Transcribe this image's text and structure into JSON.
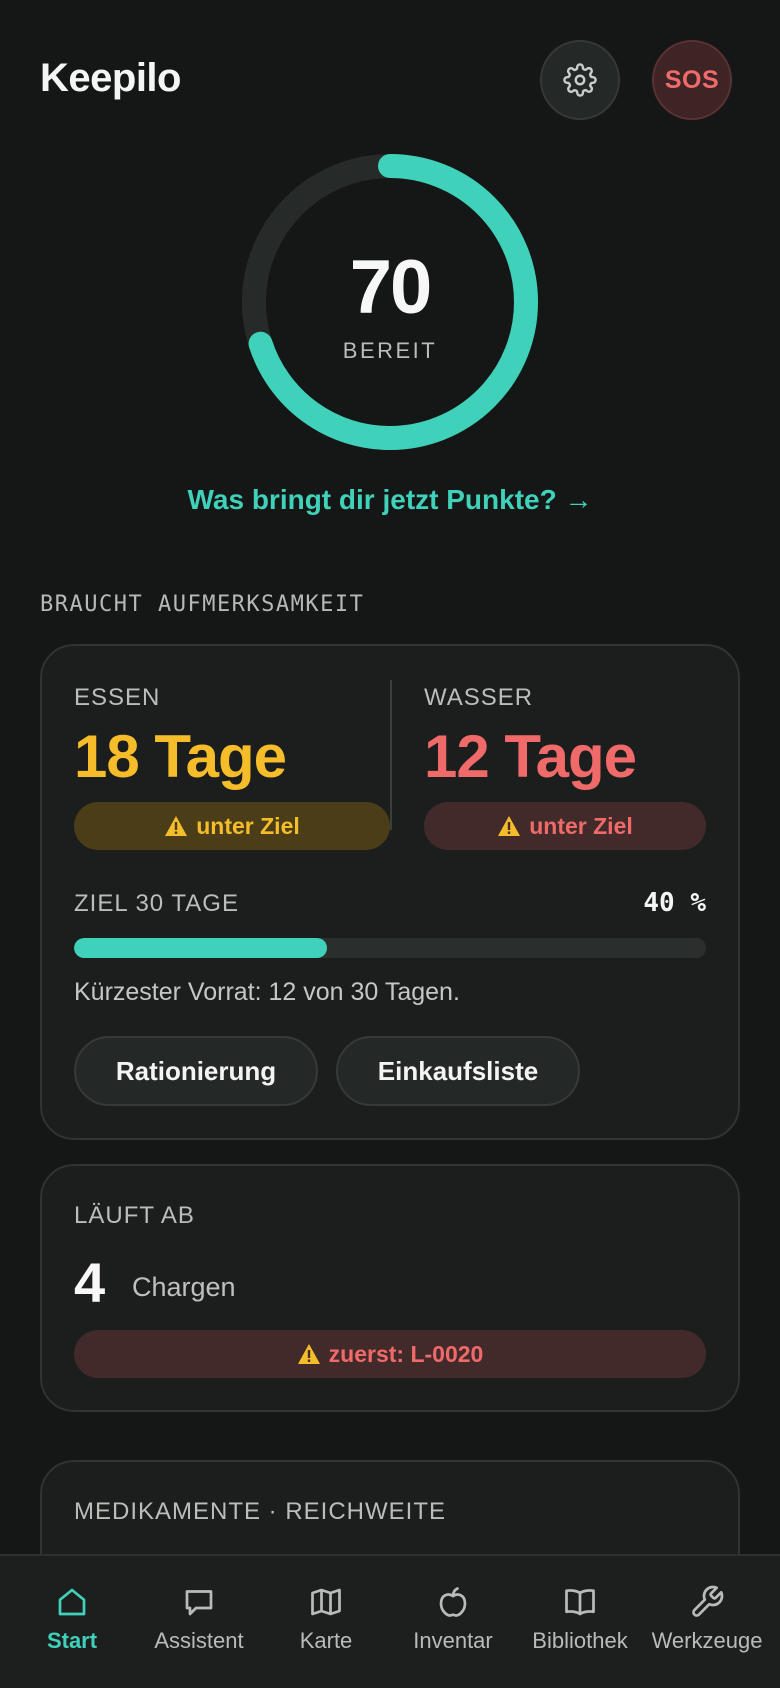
{
  "app": {
    "title": "Keepilo"
  },
  "header": {
    "sos_label": "SOS"
  },
  "score": {
    "value": "70",
    "label": "BEREIT",
    "progress_fraction": 0.7
  },
  "points_link": "Was bringt dir jetzt Punkte? →",
  "attention": {
    "section_title": "BRAUCHT AUFMERKSAMKEIT",
    "food": {
      "label": "ESSEN",
      "value": "18 Tage",
      "status": "unter Ziel"
    },
    "water": {
      "label": "WASSER",
      "value": "12 Tage",
      "status": "unter Ziel"
    },
    "goal": {
      "label": "ZIEL 30 TAGE",
      "percent_text": "40 %",
      "progress_fraction": 0.4
    },
    "note": "Kürzester Vorrat: 12 von 30 Tagen.",
    "buttons": {
      "rationing": "Rationierung",
      "shopping_list": "Einkaufsliste"
    }
  },
  "expiry": {
    "label": "LÄUFT AB",
    "count": "4",
    "unit": "Chargen",
    "first": "zuerst: L-0020"
  },
  "medication": {
    "label": "MEDIKAMENTE · REICHWEITE"
  },
  "nav": {
    "items": [
      {
        "label": "Start",
        "icon": "home-icon",
        "active": true
      },
      {
        "label": "Assistent",
        "icon": "chat-icon"
      },
      {
        "label": "Karte",
        "icon": "map-icon"
      },
      {
        "label": "Inventar",
        "icon": "apple-icon"
      },
      {
        "label": "Bibliothek",
        "icon": "book-icon"
      },
      {
        "label": "Werkzeuge",
        "icon": "wrench-icon"
      }
    ]
  },
  "colors": {
    "accent": "#3fd1b9",
    "warning": "#f6bd2a",
    "danger": "#f06a6a",
    "background": "#151716"
  }
}
